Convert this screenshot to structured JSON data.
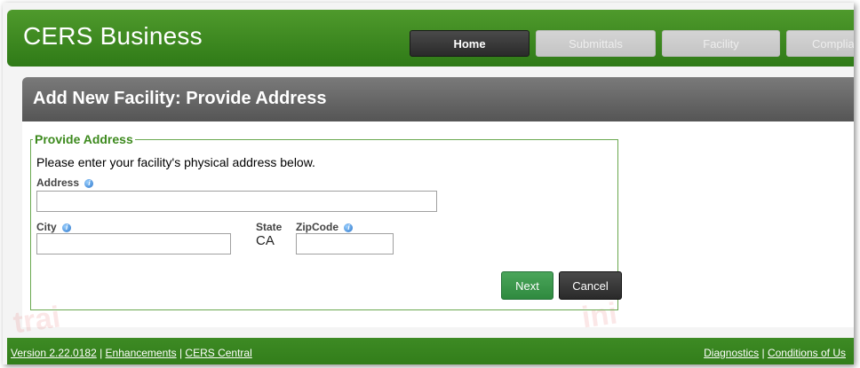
{
  "header": {
    "brand": "CERS Business",
    "nav": [
      {
        "label": "Home",
        "state": "active"
      },
      {
        "label": "Submittals",
        "state": "disabled"
      },
      {
        "label": "Facility",
        "state": "disabled"
      },
      {
        "label": "Complia",
        "state": "disabled"
      }
    ]
  },
  "page": {
    "title": "Add New Facility: Provide Address"
  },
  "form": {
    "legend": "Provide Address",
    "intro": "Please enter your facility's physical address below.",
    "address_label": "Address",
    "address_value": "",
    "city_label": "City",
    "city_value": "",
    "state_label": "State",
    "state_value": "CA",
    "zip_label": "ZipCode",
    "zip_value": "",
    "next_label": "Next",
    "cancel_label": "Cancel"
  },
  "footer": {
    "version": "Version 2.22.0182",
    "sep": " | ",
    "enhancements": "Enhancements",
    "central": "CERS Central",
    "diagnostics": "Diagnostics",
    "conditions": "Conditions of Us"
  },
  "colors": {
    "brand_green": "#3d8a24",
    "title_gray": "#666666",
    "legend_green": "#3d8a1e"
  }
}
